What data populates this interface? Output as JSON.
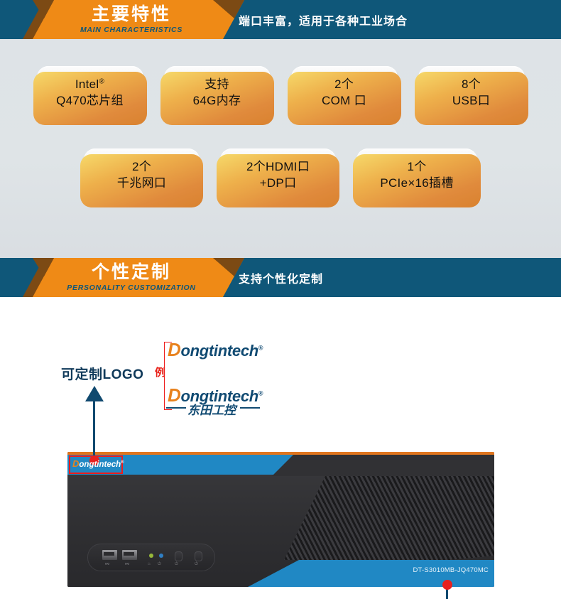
{
  "sections": {
    "main_characteristics": {
      "banner": {
        "title": "主要特性",
        "subtitle": "MAIN CHARACTERISTICS",
        "tagline": "端口丰富，适用于各种工业场合",
        "orange": "#ef8a16",
        "blue": "#0f5779",
        "notch": "#7c4a14"
      },
      "features_row1": [
        {
          "line1": "Intel",
          "sup": "®",
          "line2": "Q470芯片组"
        },
        {
          "line1": "支持",
          "sup": "",
          "line2": "64G内存"
        },
        {
          "line1": "2个",
          "sup": "",
          "line2": "COM 口"
        },
        {
          "line1": "8个",
          "sup": "",
          "line2": "USB口"
        }
      ],
      "features_row2": [
        {
          "line1": "2个",
          "sup": "",
          "line2": "千兆网口"
        },
        {
          "line1": "2个HDMI口",
          "sup": "",
          "line2": "+DP口"
        },
        {
          "line1": "1个",
          "sup": "",
          "line2": "PCIe×16插槽"
        }
      ],
      "background": "#dee3e7"
    },
    "personality_customization": {
      "banner": {
        "title": "个性定制",
        "subtitle": "PERSONALITY CUSTOMIZATION",
        "tagline": "支持个性化定制"
      },
      "logo_callout": {
        "caption": "可定制LOGO",
        "example_mark": "例",
        "brand_initial": "D",
        "brand_rest": "ongtintech",
        "brand_registered": "®",
        "brand_cn": "东田工控",
        "brand_orange": "#e8821e",
        "brand_blue": "#104a72",
        "callout_red": "#ee1c1c"
      },
      "product": {
        "model_label": "DT-S3010MB-JQ470MC",
        "logo_initial": "D",
        "logo_rest": "ongtintech",
        "logo_registered": "®",
        "accent_blue": "#2088c4",
        "accent_orange": "#e0761f",
        "chassis_dark": "#2b2b2e",
        "usb_glyph": "⚯",
        "led_power_glyph": "⏻",
        "led_hdd_glyph": "⌂"
      }
    }
  }
}
